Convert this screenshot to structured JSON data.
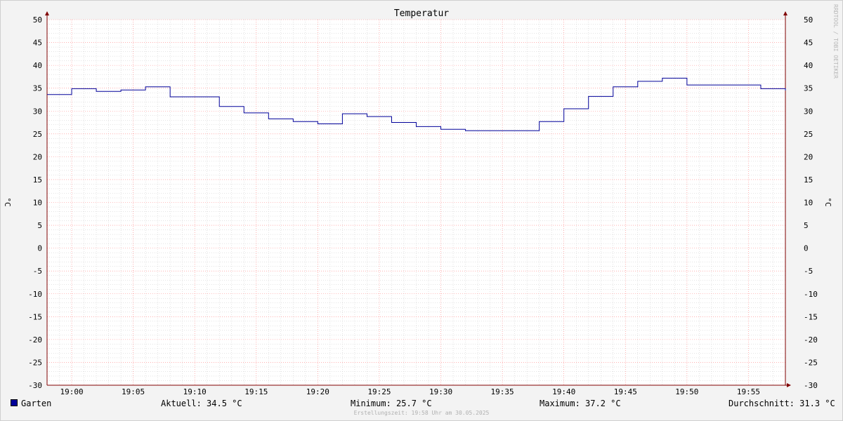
{
  "chart_data": {
    "type": "line",
    "title": "Temperatur",
    "ylabel": "°C",
    "ylabel_right": "°C",
    "ylim": [
      -30,
      50
    ],
    "y_ticks": [
      "50",
      "45",
      "40",
      "35",
      "30",
      "25",
      "20",
      "15",
      "10",
      "5",
      "0",
      "-5",
      "-10",
      "-15",
      "-20",
      "-25",
      "-30"
    ],
    "x_ticks": [
      "19:00",
      "19:05",
      "19:10",
      "19:15",
      "19:20",
      "19:25",
      "19:30",
      "19:35",
      "19:40",
      "19:45",
      "19:50",
      "19:55"
    ],
    "x_range": [
      "18:58",
      "19:58"
    ],
    "grid": true,
    "series": [
      {
        "name": "Garten",
        "color": "#000099",
        "step": true,
        "points": [
          [
            "18:58",
            33.6
          ],
          [
            "19:00",
            34.9
          ],
          [
            "19:02",
            34.3
          ],
          [
            "19:04",
            34.6
          ],
          [
            "19:06",
            35.3
          ],
          [
            "19:08",
            33.1
          ],
          [
            "19:10",
            33.1
          ],
          [
            "19:12",
            31.0
          ],
          [
            "19:14",
            29.6
          ],
          [
            "19:16",
            28.3
          ],
          [
            "19:18",
            27.7
          ],
          [
            "19:20",
            27.2
          ],
          [
            "19:22",
            29.4
          ],
          [
            "19:24",
            28.8
          ],
          [
            "19:26",
            27.5
          ],
          [
            "19:28",
            26.6
          ],
          [
            "19:30",
            26.0
          ],
          [
            "19:32",
            25.7
          ],
          [
            "19:34",
            25.7
          ],
          [
            "19:36",
            25.7
          ],
          [
            "19:38",
            27.7
          ],
          [
            "19:40",
            30.5
          ],
          [
            "19:42",
            33.2
          ],
          [
            "19:44",
            35.3
          ],
          [
            "19:46",
            36.5
          ],
          [
            "19:48",
            37.2
          ],
          [
            "19:50",
            35.7
          ],
          [
            "19:52",
            35.7
          ],
          [
            "19:54",
            35.7
          ],
          [
            "19:56",
            34.9
          ],
          [
            "19:58",
            34.5
          ]
        ]
      }
    ]
  },
  "legend": {
    "name": "Garten",
    "current": "Aktuell: 34.5 °C",
    "minimum": "Minimum: 25.7 °C",
    "maximum": "Maximum: 37.2 °C",
    "average": "Durchschnitt: 31.3 °C"
  },
  "footnote": "Erstellungszeit: 19:58 Uhr am 30.05.2025",
  "watermark": "RRDTOOL / TOBI OETIKER",
  "colors": {
    "series": "#000099",
    "major_grid": "#ff8080",
    "minor_grid": "#c8c8c8",
    "axis": "#800000",
    "background": "#f3f3f3",
    "plot_background": "#ffffff"
  }
}
